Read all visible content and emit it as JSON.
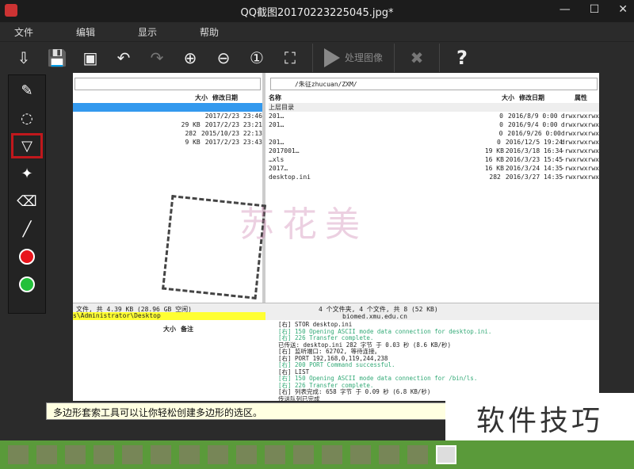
{
  "window": {
    "title": "QQ截图20170223225045.jpg*",
    "minimize": "—",
    "maximize": "☐",
    "close": "✕"
  },
  "menu": [
    "文件",
    "编辑",
    "显示",
    "帮助"
  ],
  "toolbar": {
    "icons": [
      "open-icon",
      "save-icon",
      "preview-icon",
      "undo-icon",
      "redo-icon",
      "zoom-in-icon",
      "zoom-out-icon",
      "actual-size-icon",
      "fit-icon"
    ],
    "glyphs": [
      "⇩",
      "💾",
      "▣",
      "↶",
      "↷",
      "⊕",
      "⊖",
      "①",
      "⛶"
    ],
    "process_label": "处理图像",
    "cancel": "✖",
    "help": "?"
  },
  "tools": [
    {
      "name": "pencil",
      "glyph": "✎"
    },
    {
      "name": "lasso",
      "glyph": "◌"
    },
    {
      "name": "polygon-lasso",
      "glyph": "▽",
      "selected": true
    },
    {
      "name": "magic-wand",
      "glyph": "✦"
    },
    {
      "name": "eraser",
      "glyph": "⌫"
    },
    {
      "name": "line",
      "glyph": "╱"
    }
  ],
  "colors": {
    "primary": "#e8141c",
    "secondary": "#22c03a"
  },
  "left_pane": {
    "headers": {
      "size": "大小",
      "date": "修改日期"
    },
    "rows": [
      {
        "size": "",
        "date": "2017/2/23 23:46"
      },
      {
        "size": "29 KB",
        "date": "2017/2/23 23:21"
      },
      {
        "size": "282",
        "date": "2015/10/23 22:13"
      },
      {
        "size": "9 KB",
        "date": "2017/2/23 23:43"
      }
    ],
    "status": "文件, 共 4.39 KB (28.96 GB 空闲)",
    "path": "s\\Administrator\\Desktop",
    "bottom_headers": {
      "size": "大小",
      "note": "备注"
    }
  },
  "right_pane": {
    "address": "/朱征zhucuan/ZXM/",
    "headers": {
      "name": "名称",
      "size": "大小",
      "date": "修改日期",
      "attr": "属性"
    },
    "rows": [
      {
        "name": "上层目录",
        "size": "",
        "date": "",
        "attr": ""
      },
      {
        "name": "201…",
        "size": "0",
        "date": "2016/8/9 0:00",
        "attr": "drwxrwxrwx"
      },
      {
        "name": "201…",
        "size": "0",
        "date": "2016/9/4 0:00",
        "attr": "drwxrwxrwx"
      },
      {
        "name": "",
        "size": "0",
        "date": "2016/9/26 0:00",
        "attr": "drwxrwxrwx"
      },
      {
        "name": "201…",
        "size": "0",
        "date": "2016/12/5 19:24",
        "attr": "drwxrwxrwx"
      },
      {
        "name": "2017001…",
        "size": "19 KB",
        "date": "2016/3/18 16:34",
        "attr": "-rwxrwxrwx"
      },
      {
        "name": "…xls",
        "size": "16 KB",
        "date": "2016/3/23 15:45",
        "attr": "-rwxrwxrwx"
      },
      {
        "name": "2017…",
        "size": "16 KB",
        "date": "2016/3/24 14:35",
        "attr": "-rwxrwxrwx"
      },
      {
        "name": "desktop.ini",
        "size": "282",
        "date": "2016/3/27 14:35",
        "attr": "-rwxrwxrwx"
      }
    ],
    "status": "4 个文件夹, 4 个文件, 共 8 (52 KB)",
    "server": "biomed.xmu.edu.cn"
  },
  "log": [
    "[右] STOR desktop.ini",
    "[右] 150 Opening ASCII mode data connection for desktop.ini.",
    "[右] 226 Transfer complete.",
    "已传送: desktop.ini 282 字节 于 0.03 秒 (8.6 KB/秒)",
    "[右] 监听端口: 62702, 等待连接。",
    "[右] PORT 192,168,0,119,244,238",
    "[右] 200 PORT Command successful.",
    "[右] LIST",
    "[右] 150 Opening ASCII mode data connection for /bin/ls.",
    "[右] 226 Transfer complete.",
    "[右] 列表完成: 658 字节 于 0.09 秒 (6.8 KB/秒)",
    "传送队列已完成",
    "已传送 1 个文件, 总计 282 字节 于 0.59 秒 (8.6 KB/秒)"
  ],
  "watermark": "苏花美",
  "hint": "多边形套索工具可以让你轻松创建多边形的选区。",
  "badge": "软件技巧"
}
